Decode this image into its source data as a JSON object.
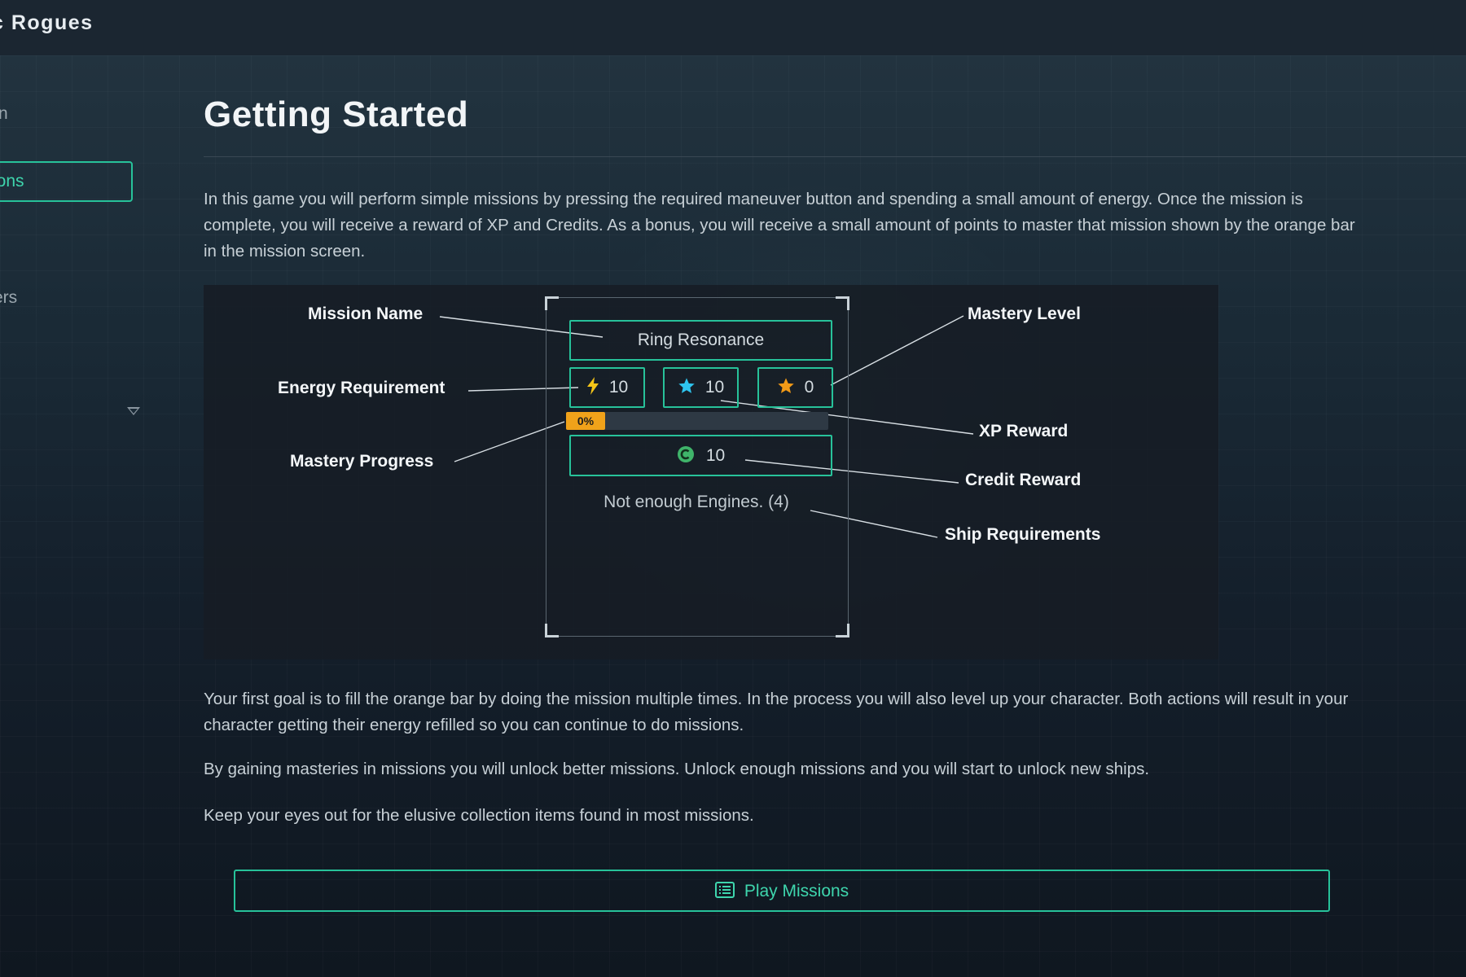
{
  "app": {
    "title": "c Rogues"
  },
  "sidebar": {
    "items": [
      {
        "label": "n"
      },
      {
        "label": "ssions",
        "active": true
      },
      {
        "label": "ers"
      }
    ]
  },
  "content": {
    "title": "Getting Started",
    "intro": "In this game you will perform simple missions by pressing the required maneuver button and spending a small amount of energy. Once the mission is complete, you will receive a reward of XP and Credits. As a bonus, you will receive a small amount of points to master that mission shown by the orange bar in the mission screen.",
    "para2": "Your first goal is to fill the orange bar by doing the mission multiple times. In the process you will also level up your character. Both actions will result in your character getting their energy refilled so you can continue to do missions.",
    "para3": "By gaining masteries in missions you will unlock better missions. Unlock enough missions and you will start to unlock new ships.",
    "para4": "Keep your eyes out for the elusive collection items found in most missions.",
    "play_button": "Play Missions"
  },
  "mission_card": {
    "name": "Ring Resonance",
    "energy": "10",
    "xp": "10",
    "mastery_level": "0",
    "mastery_progress_text": "0%",
    "mastery_progress_value": 0,
    "credits": "10",
    "requirement": "Not enough Engines. (4)"
  },
  "labels": {
    "mission_name": "Mission Name",
    "energy_requirement": "Energy Requirement",
    "mastery_progress": "Mastery Progress",
    "mastery_level": "Mastery Level",
    "xp_reward": "XP Reward",
    "credit_reward": "Credit Reward",
    "ship_requirements": "Ship Requirements"
  },
  "colors": {
    "accent": "#27c29a",
    "progress": "#f0a21a",
    "xp_star": "#2ec5ef",
    "mastery_star": "#f29a17",
    "credit": "#3fb46a"
  },
  "icons": {
    "energy": "lightning-icon",
    "xp": "star-icon",
    "mastery": "star-icon",
    "credit": "credit-coin-icon",
    "play": "list-icon",
    "dropdown": "chevron-down-icon"
  }
}
